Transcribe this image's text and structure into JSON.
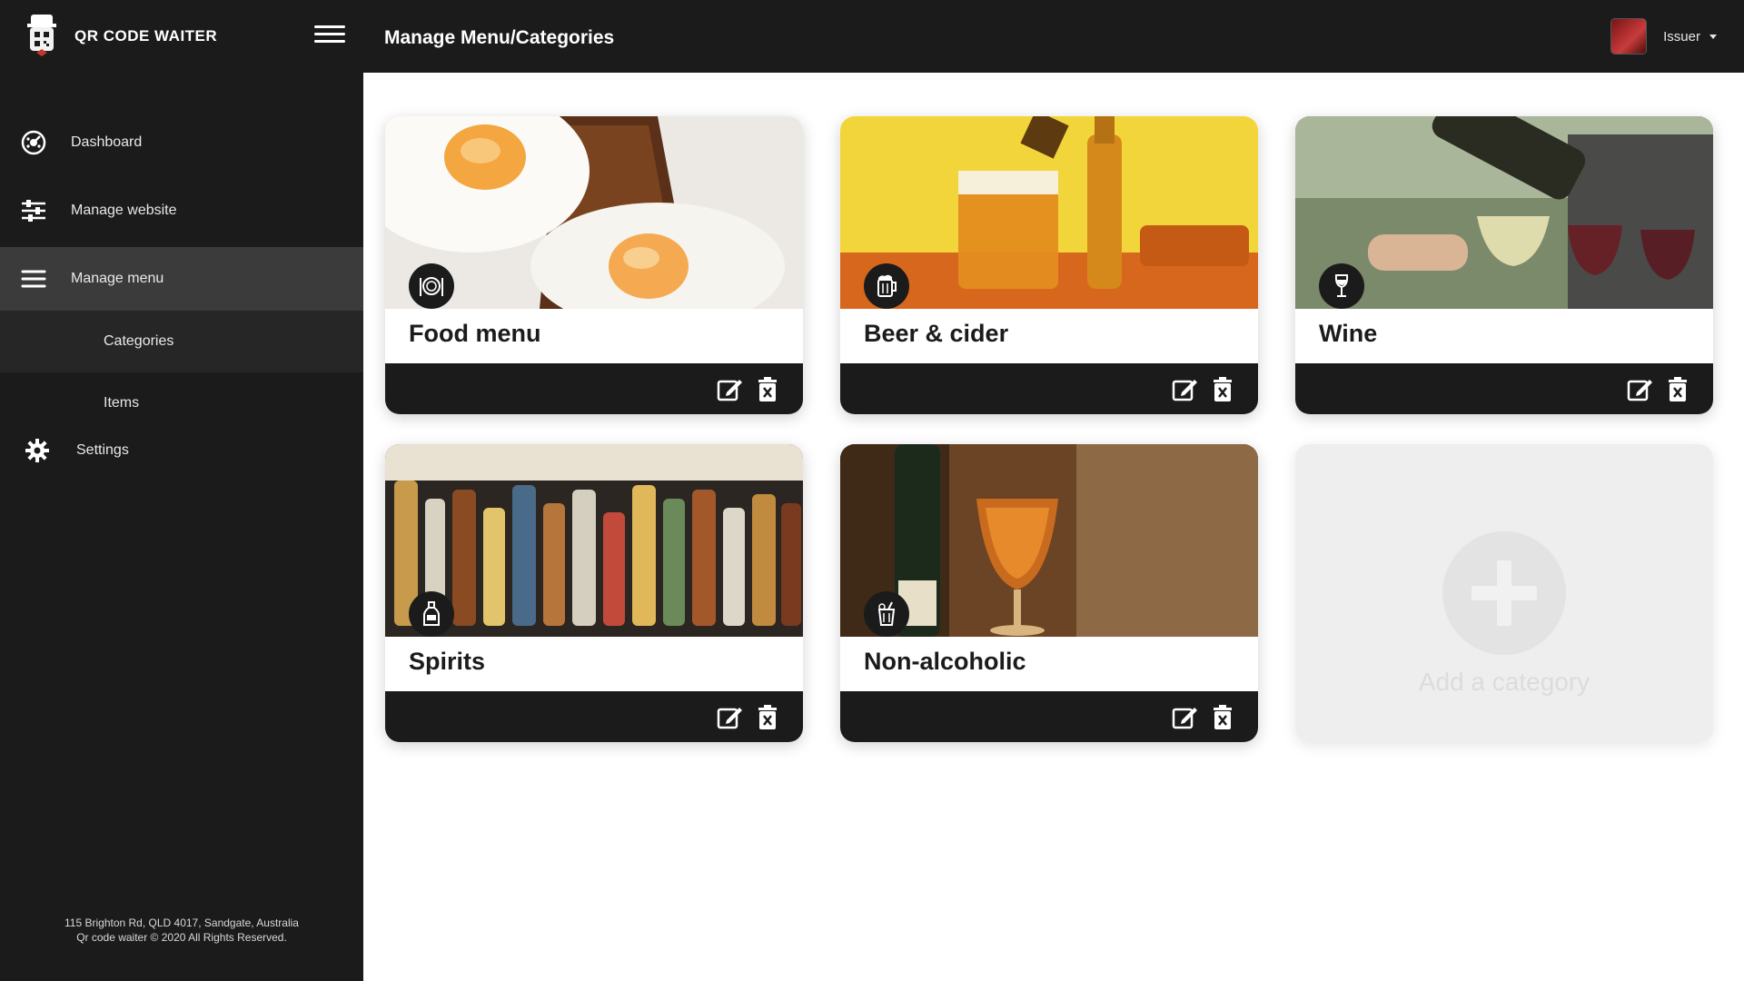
{
  "brand": {
    "name": "QR CODE WAITER"
  },
  "sidebar": {
    "items": [
      {
        "label": "Dashboard",
        "icon": "dashboard-icon"
      },
      {
        "label": "Manage website",
        "icon": "sliders-icon"
      },
      {
        "label": "Manage menu",
        "icon": "menu-lines-icon"
      },
      {
        "label": "Categories"
      },
      {
        "label": "Items"
      },
      {
        "label": "Settings",
        "icon": "gear-icon"
      }
    ],
    "footer_address": "115 Brighton Rd, QLD 4017, Sandgate, Australia",
    "footer_copyright": "Qr code waiter © 2020 All Rights Reserved."
  },
  "header": {
    "title": "Manage Menu/Categories",
    "user_name": "Issuer"
  },
  "categories": [
    {
      "title": "Food menu",
      "icon": "plate-cutlery-icon"
    },
    {
      "title": "Beer & cider",
      "icon": "beer-mug-icon"
    },
    {
      "title": "Wine",
      "icon": "wine-glass-icon"
    },
    {
      "title": "Spirits",
      "icon": "bottle-icon"
    },
    {
      "title": "Non-alcoholic",
      "icon": "soft-drink-icon"
    }
  ],
  "add_card": {
    "label": "Add a category"
  },
  "colors": {
    "dark": "#1b1b1b",
    "active": "#3b3b3b",
    "sub_active": "#262626",
    "add_bg": "#eeeeee"
  }
}
